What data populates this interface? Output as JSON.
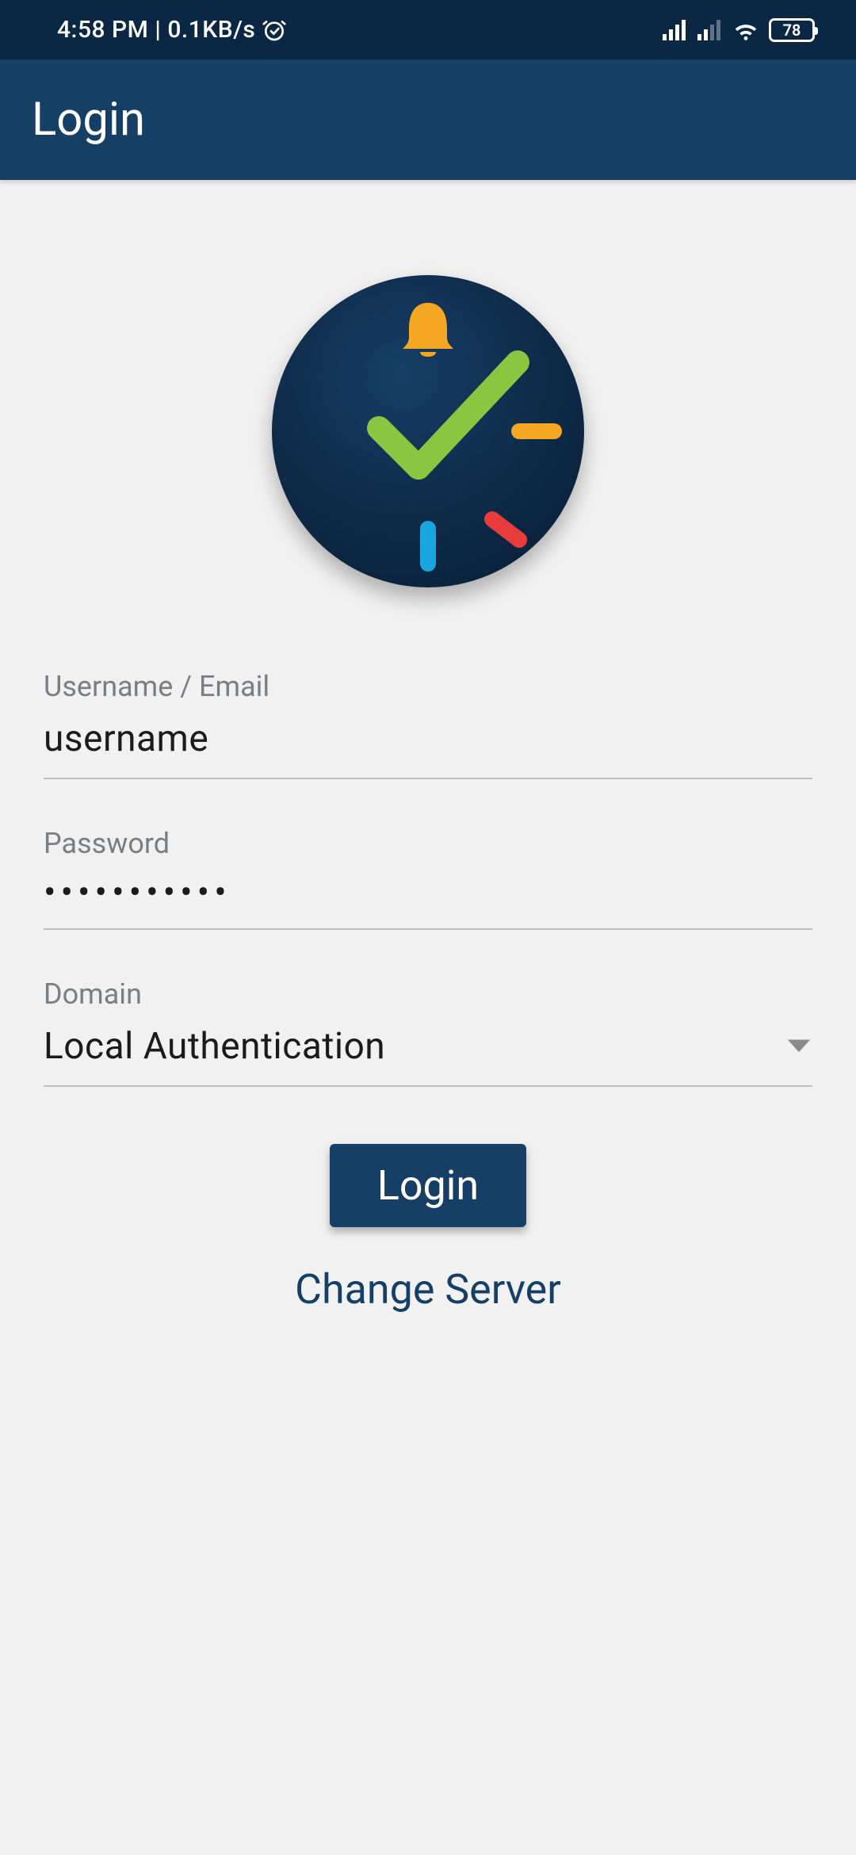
{
  "status": {
    "time": "4:58 PM",
    "net_speed": "0.1KB/s",
    "battery": "78"
  },
  "header": {
    "title": "Login"
  },
  "logo": {
    "name": "app-clock-logo"
  },
  "form": {
    "username_label": "Username / Email",
    "username_value": "username",
    "password_label": "Password",
    "password_masked": "•••••••••••",
    "domain_label": "Domain",
    "domain_value": "Local Authentication",
    "login_label": "Login",
    "change_server_label": "Change Server"
  }
}
